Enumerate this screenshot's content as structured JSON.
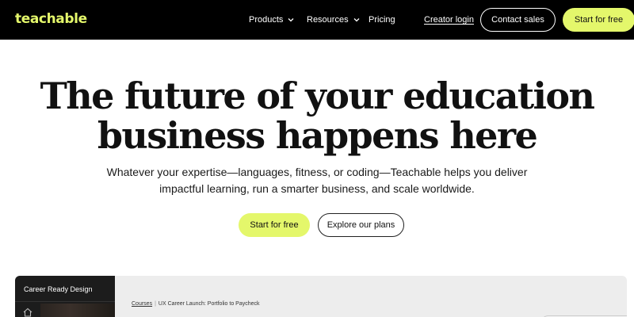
{
  "brand": {
    "logo_text": "teachable",
    "accent": "#E4F76B"
  },
  "nav": {
    "items": [
      {
        "label": "Products"
      },
      {
        "label": "Resources"
      },
      {
        "label": "Pricing"
      }
    ],
    "creator_login": "Creator login",
    "contact_sales": "Contact sales",
    "start_free": "Start for free"
  },
  "hero": {
    "headline_line1": "The future of your education",
    "headline_line2": "business happens here",
    "subtext_line1": "Whatever your expertise—languages, fitness, or coding—Teachable helps you deliver",
    "subtext_line2": "impactful learning, run a smarter business, and scale worldwide.",
    "primary_cta": "Start for free",
    "secondary_cta": "Explore our plans"
  },
  "preview": {
    "sidebar_title": "Career Ready Design",
    "breadcrumb_root": "Courses",
    "breadcrumb_separator": "|",
    "breadcrumb_current": "UX Career Launch: Portfolio to Paycheck"
  }
}
